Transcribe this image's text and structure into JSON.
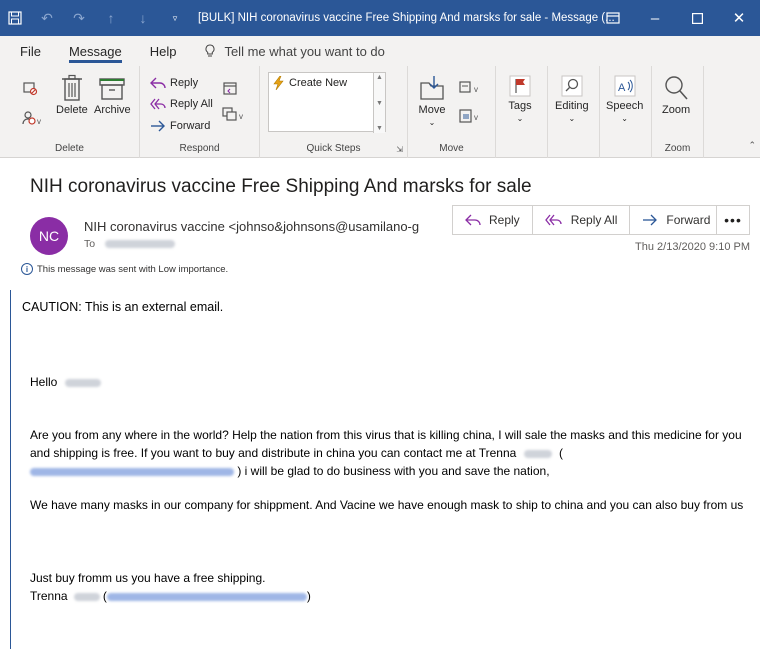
{
  "window": {
    "title": "[BULK] NIH coronavirus vaccine Free Shipping And marsks for sale  -  Message (..."
  },
  "tabs": [
    {
      "label": "File"
    },
    {
      "label": "Message"
    },
    {
      "label": "Help"
    }
  ],
  "tell_me": "Tell me what you want to do",
  "ribbon": {
    "delete_group": {
      "label": "Delete",
      "delete": "Delete",
      "archive": "Archive"
    },
    "respond_group": {
      "label": "Respond",
      "reply": "Reply",
      "reply_all": "Reply All",
      "forward": "Forward"
    },
    "quick_steps_group": {
      "label": "Quick Steps",
      "create_new": "Create New"
    },
    "move_group": {
      "label": "Move",
      "move": "Move"
    },
    "tags": "Tags",
    "editing": "Editing",
    "speech": "Speech",
    "zoom_group": {
      "label": "Zoom",
      "zoom": "Zoom"
    }
  },
  "message": {
    "subject": "NIH coronavirus vaccine Free Shipping And marsks for sale",
    "avatar_initials": "NC",
    "sender": "NIH coronavirus vaccine <johnso&johnsons@usamilano-g",
    "to_label": "To",
    "date": "Thu 2/13/2020 9:10 PM",
    "importance_note": "This message was sent with Low importance.",
    "actions": {
      "reply": "Reply",
      "reply_all": "Reply All",
      "forward": "Forward",
      "more": "•••"
    },
    "avatar_color": "#8a2da5"
  },
  "body": {
    "caution": "CAUTION: This is an external email.",
    "hello": "Hello",
    "para1_a": "Are you from any where in the world?  Help the nation from this virus that is killing china,  I will sale the masks and  this medicine for you and shipping is free. If you want to buy and distribute in china you can contact me at Trenna",
    "para1_b": "(",
    "para1_c": ")  i will be glad to do business with you and save the nation,",
    "para2": "We have many masks in our company for shippment. And Vacine we have enough mask to ship to china and you can also buy from us",
    "sig_line1": "Just buy fromm us you have a free shipping.",
    "sig_name": "Trenna",
    "sig_open": "(",
    "sig_close": ")"
  },
  "colors": {
    "titlebar": "#2b5797",
    "accent": "#2b5797"
  }
}
